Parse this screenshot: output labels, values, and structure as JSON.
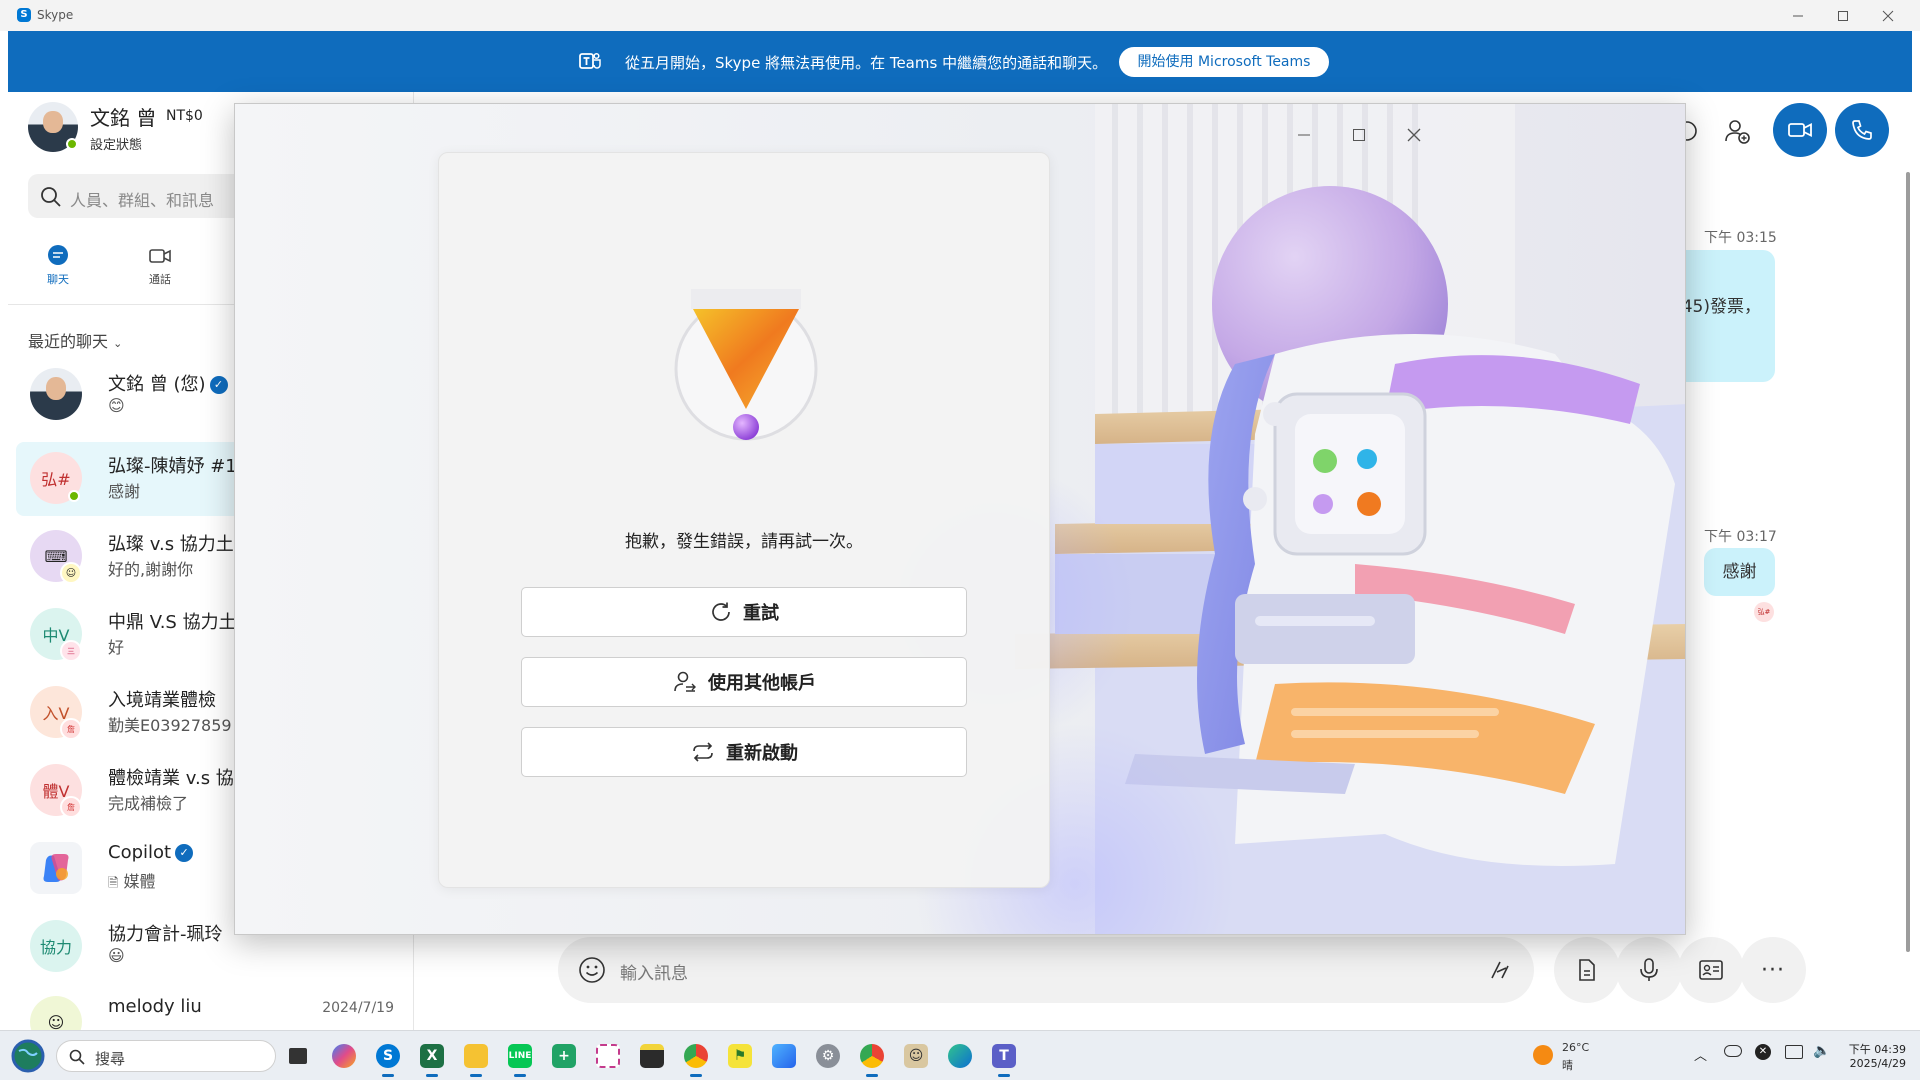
{
  "window": {
    "title": "Skype"
  },
  "banner": {
    "message": "從五月開始，Skype 將無法再使用。在 Teams 中繼續您的通話和聊天。",
    "button_label": "開始使用 Microsoft Teams"
  },
  "profile": {
    "name": "文銘 曾",
    "credit": "NT$0",
    "status": "設定狀態"
  },
  "search": {
    "placeholder": "人員、群組、和訊息"
  },
  "nav": {
    "chats": "聊天",
    "calls": "通話"
  },
  "recent": {
    "header": "最近的聊天"
  },
  "chats": [
    {
      "initials": "",
      "name": "文銘 曾 (您)",
      "last": "😊",
      "date": ""
    },
    {
      "initials": "弘#",
      "name": "弘璨-陳婧妤 #1",
      "last": "感謝",
      "date": ""
    },
    {
      "initials": "",
      "name": "弘璨 v.s 協力土",
      "last": "好的,謝謝你",
      "date": ""
    },
    {
      "initials": "中V",
      "name": "中鼎 V.S 協力土",
      "last": "好",
      "date": ""
    },
    {
      "initials": "入V",
      "name": "入境靖業體檢",
      "last": "勤美E03927859",
      "date": ""
    },
    {
      "initials": "體V",
      "name": "體檢靖業 v.s 協",
      "last": "完成補檢了",
      "date": ""
    },
    {
      "initials": "",
      "name": "Copilot",
      "last": "媒體",
      "date": ""
    },
    {
      "initials": "協力",
      "name": "協力會計-珮玲",
      "last": "😃",
      "date": ""
    },
    {
      "initials": "",
      "name": "melody liu",
      "last": "",
      "date": "2024/7/19"
    }
  ],
  "conversation": {
    "time1": "下午 03:15",
    "msg1": "45)發票，",
    "time2": "下午 03:17",
    "msg2": "感謝"
  },
  "composer": {
    "placeholder": "輸入訊息"
  },
  "error_dialog": {
    "message": "抱歉，發生錯誤，請再試一次。",
    "retry_label": "重試",
    "other_account_label": "使用其他帳戶",
    "restart_label": "重新啟動"
  },
  "taskbar": {
    "search_placeholder": "搜尋",
    "weather_temp": "26°C",
    "weather_cond": "晴",
    "time": "下午 04:39",
    "date": "2025/4/29"
  },
  "colors": {
    "accent": "#0f6cbd",
    "bubble": "#cbf2fb",
    "presence": "#6bb700"
  }
}
